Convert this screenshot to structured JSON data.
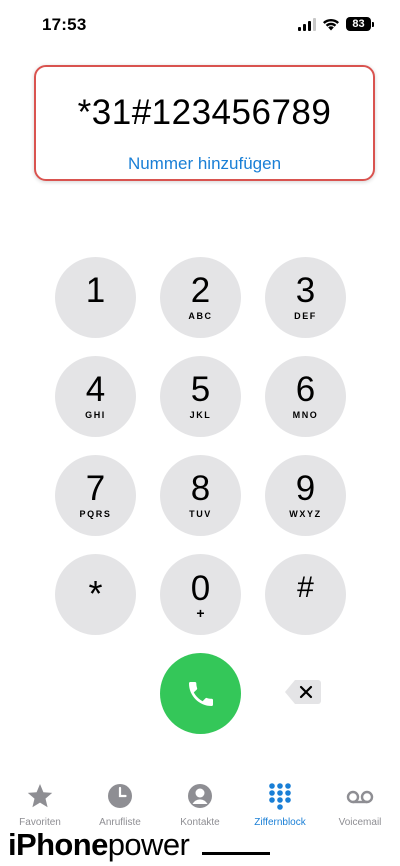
{
  "status_bar": {
    "time": "17:53",
    "battery_level": "83",
    "signal_bars": 3,
    "icons": [
      "signal-icon",
      "wifi-icon",
      "battery-icon"
    ]
  },
  "display": {
    "number": "*31#123456789",
    "add_number_label": "Nummer hinzufügen",
    "highlight_color": "#d9534f",
    "link_color": "#1a7fd6"
  },
  "keypad": {
    "keys": [
      {
        "digit": "1",
        "letters": ""
      },
      {
        "digit": "2",
        "letters": "ABC"
      },
      {
        "digit": "3",
        "letters": "DEF"
      },
      {
        "digit": "4",
        "letters": "GHI"
      },
      {
        "digit": "5",
        "letters": "JKL"
      },
      {
        "digit": "6",
        "letters": "MNO"
      },
      {
        "digit": "7",
        "letters": "PQRS"
      },
      {
        "digit": "8",
        "letters": "TUV"
      },
      {
        "digit": "9",
        "letters": "WXYZ"
      },
      {
        "digit": "*",
        "letters": ""
      },
      {
        "digit": "0",
        "letters": "+"
      },
      {
        "digit": "#",
        "letters": ""
      }
    ],
    "key_color": "#e4e4e6",
    "call_color": "#34c759",
    "icons": [
      "phone-icon",
      "delete-icon"
    ]
  },
  "tab_bar": {
    "active_color": "#1a7fd6",
    "inactive_color": "#8e8e93",
    "tabs": [
      {
        "label": "Favoriten",
        "icon": "star-icon",
        "active": false
      },
      {
        "label": "Anrufliste",
        "icon": "clock-icon",
        "active": false
      },
      {
        "label": "Kontakte",
        "icon": "contact-icon",
        "active": false
      },
      {
        "label": "Ziffernblock",
        "icon": "keypad-icon",
        "active": true
      },
      {
        "label": "Voicemail",
        "icon": "voicemail-icon",
        "active": false
      }
    ]
  },
  "watermark": {
    "part1": "iPhone",
    "part2": "power"
  }
}
